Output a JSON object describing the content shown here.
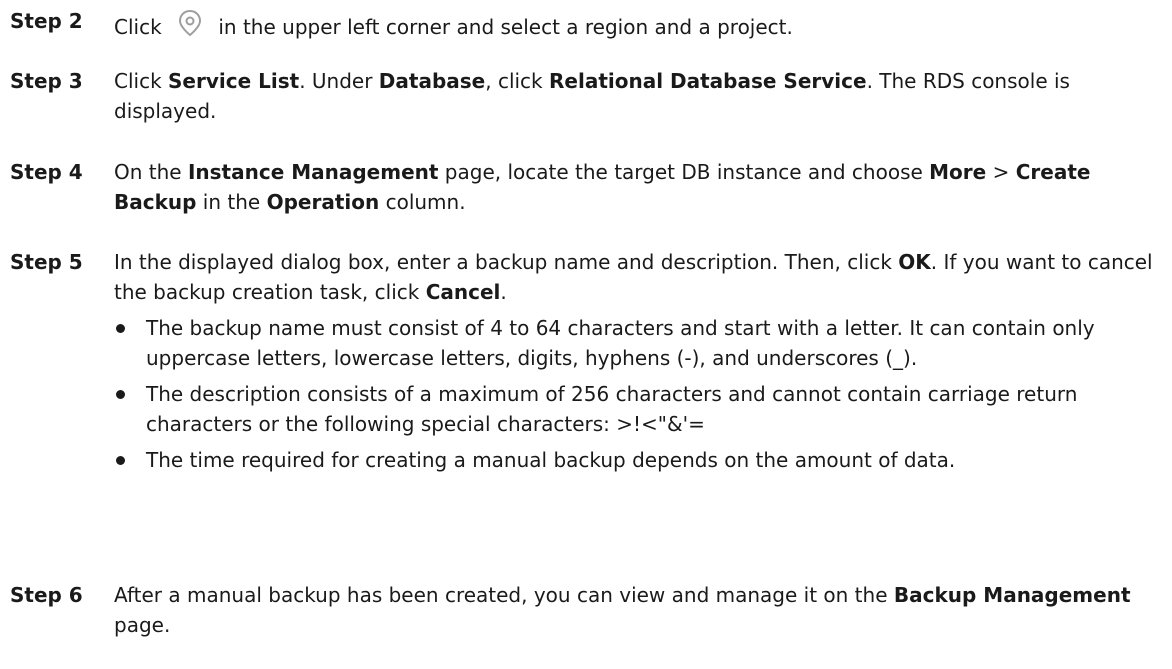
{
  "steps": [
    {
      "label": "Step 2",
      "parts": [
        "Click ",
        "{icon}",
        " in the upper left corner and select a region and a project."
      ]
    },
    {
      "label": "Step 3",
      "t1": "Click ",
      "b1": "Service List",
      "t2": ". Under ",
      "b2": "Database",
      "t3": ", click ",
      "b3": "Relational Database Service",
      "t4": ". The RDS console is displayed."
    },
    {
      "label": "Step 4",
      "t1": "On the ",
      "b1": "Instance Management",
      "t2": " page, locate the target DB instance and choose ",
      "b2": "More",
      "t3": " > ",
      "b3": "Create Backup",
      "t4": " in the ",
      "b4": "Operation",
      "t5": " column."
    },
    {
      "label": "Step 5",
      "t1": "In the displayed dialog box, enter a backup name and description. Then, click ",
      "b1": "OK",
      "t2": ". If you want to cancel the backup creation task, click ",
      "b2": "Cancel",
      "t3": ".",
      "bullets": [
        "The backup name must consist of 4 to 64 characters and start with a letter. It can contain only uppercase letters, lowercase letters, digits, hyphens (-), and underscores (_).",
        "The description consists of a maximum of 256 characters and cannot contain carriage return characters or the following special characters: >!<\"&'=",
        "The time required for creating a manual backup depends on the amount of data."
      ]
    },
    {
      "label": "Step 6",
      "t1": "After a manual backup has been created, you can view and manage it on the ",
      "b1": "Backup Management",
      "t2": " page."
    }
  ],
  "icons": {
    "step2_icon": "location-pin-icon",
    "icon_color": "#9e9e9e"
  }
}
